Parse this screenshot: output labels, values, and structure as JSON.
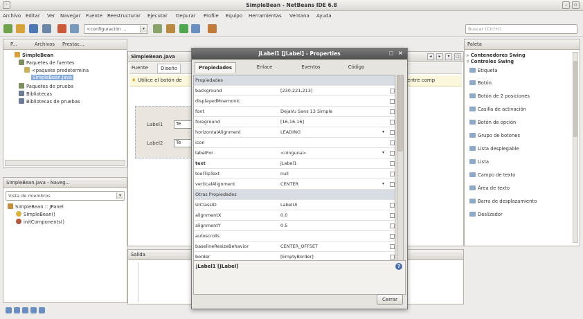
{
  "window": {
    "title": "SimpleBean - NetBeans IDE 6.8"
  },
  "menu": [
    "Archivo",
    "Editar",
    "Ver",
    "Navegar",
    "Fuente",
    "Reestructurar",
    "Ejecutar",
    "Depurar",
    "Profile",
    "Equipo",
    "Herramientas",
    "Ventana",
    "Ayuda"
  ],
  "toolbar": {
    "config_value": "<configuración ...",
    "search_placeholder": "Buscar (Ctrl+I)"
  },
  "projects_panel": {
    "tabs": [
      "P...",
      "Archivos",
      "Prestac..."
    ],
    "side_label": "Properties",
    "tree": [
      {
        "label": "SimpleBean",
        "depth": 0
      },
      {
        "label": "Paquetes de fuentes",
        "depth": 1
      },
      {
        "label": "<paquete predetermina",
        "depth": 2
      },
      {
        "label": "SimpleBean.java",
        "depth": 3,
        "selected": true
      },
      {
        "label": "Paquetes de prueba",
        "depth": 1
      },
      {
        "label": "Bibliotecas",
        "depth": 1
      },
      {
        "label": "Bibliotecas de pruebas",
        "depth": 1
      }
    ]
  },
  "navigator_panel": {
    "title": "SimpleBean.java - Naveg...",
    "combo": "Vista de miembros",
    "tree": [
      {
        "label": "SimpleBean :: JPanel",
        "depth": 0
      },
      {
        "label": "SimpleBean()",
        "depth": 1
      },
      {
        "label": "initComponents()",
        "depth": 1
      }
    ]
  },
  "editor": {
    "tab": "SimpleBean.java",
    "subtabs": [
      "Fuente",
      "Diseño"
    ],
    "hint": "Utilice el botón de",
    "hint_right": "posición entre comp",
    "labels": [
      "Label1",
      "Label2"
    ],
    "field_stub": "Te"
  },
  "output": {
    "title": "Salida"
  },
  "palette": {
    "title": "Paleta",
    "items": [
      "Contenedores Swing",
      "Controles Swing",
      "Etiqueta",
      "Botón",
      "Botón de 2 posiciones",
      "Casilla de activación",
      "Botón de opción",
      "Grupo de botones",
      "Lista desplegable",
      "Lista",
      "Campo de texto",
      "Área de texto",
      "Barra de desplazamiento",
      "Deslizador"
    ]
  },
  "dialog": {
    "title": "jLabel1 [JLabel] - Properties",
    "tabs": [
      "Propiedades",
      "Enlace",
      "Eventos",
      "Código"
    ],
    "rows": [
      {
        "name": "Propiedades",
        "value": "",
        "category": true
      },
      {
        "name": "background",
        "value": "[230,221,213]"
      },
      {
        "name": "displayedMnemonic",
        "value": ""
      },
      {
        "name": "font",
        "value": "DejaVu Sans 13 Simple"
      },
      {
        "name": "foreground",
        "value": "[16,16,16]"
      },
      {
        "name": "horizontalAlignment",
        "value": "LEADING",
        "dropdown": true
      },
      {
        "name": "icon",
        "value": ""
      },
      {
        "name": "labelFor",
        "value": "<ninguna>",
        "dropdown": true
      },
      {
        "name": "text",
        "value": "jLabel1",
        "bold": true
      },
      {
        "name": "toolTipText",
        "value": "null"
      },
      {
        "name": "verticalAlignment",
        "value": "CENTER",
        "dropdown": true
      },
      {
        "name": "Otras Propiedades",
        "value": "",
        "category": true
      },
      {
        "name": "UIClassID",
        "value": "LabelUI"
      },
      {
        "name": "alignmentX",
        "value": "0.0"
      },
      {
        "name": "alignmentY",
        "value": "0.5"
      },
      {
        "name": "autoscrolls",
        "value": ""
      },
      {
        "name": "baselineResizeBehavior",
        "value": "CENTER_OFFSET"
      },
      {
        "name": "border",
        "value": "[EmptyBorder]"
      },
      {
        "name": "componentPopupMenu",
        "value": "<ninguna>",
        "dropdown": true
      },
      {
        "name": "cursor",
        "value": "Cursor predeterminado",
        "dropdown": true
      }
    ],
    "footer_label": "jLabel1 [JLabel]",
    "close_label": "Cerrar"
  },
  "colors": {
    "accent": "#86abd9",
    "dialog_title": "#5a5a5a"
  }
}
